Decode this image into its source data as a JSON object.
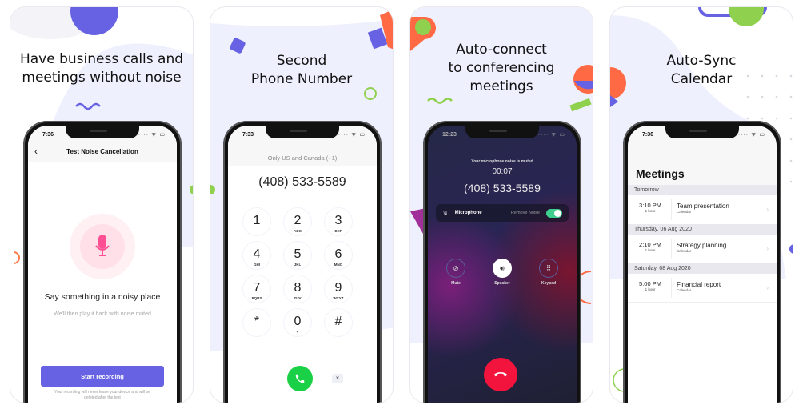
{
  "panels": [
    {
      "headline_lines": [
        "Have business calls and",
        "meetings without noise"
      ],
      "status_time": "7:36",
      "screen_title": "Test Noise Cancellation",
      "back_icon": "chevron-left-icon",
      "prompt": "Say something in a noisy place",
      "subprompt": "We'll then play it back with noise muted",
      "button_label": "Start recording",
      "footnote": "Your recording will never leave your device and will be deleted after the test",
      "accent": "#6762e3",
      "mic_color": "#ff4f93"
    },
    {
      "headline_lines": [
        "Second",
        "Phone Number"
      ],
      "status_time": "7:33",
      "region_note": "Only US and Canada (+1)",
      "entered_number": "(408) 533-5589",
      "keys": [
        {
          "digit": "1",
          "letters": ""
        },
        {
          "digit": "2",
          "letters": "ABC"
        },
        {
          "digit": "3",
          "letters": "DEF"
        },
        {
          "digit": "4",
          "letters": "GHI"
        },
        {
          "digit": "5",
          "letters": "JKL"
        },
        {
          "digit": "6",
          "letters": "MNO"
        },
        {
          "digit": "7",
          "letters": "PQRS"
        },
        {
          "digit": "8",
          "letters": "TUV"
        },
        {
          "digit": "9",
          "letters": "WXYZ"
        },
        {
          "digit": "*",
          "letters": ""
        },
        {
          "digit": "0",
          "letters": "+"
        },
        {
          "digit": "#",
          "letters": ""
        }
      ],
      "delete_glyph": "×",
      "call_color": "#19d046"
    },
    {
      "headline_lines": [
        "Auto-connect",
        "to conferencing",
        "meetings"
      ],
      "status_time": "12:23",
      "muted_note": "Your microphone noise is muted",
      "timer": "00:07",
      "number": "(408) 533-5589",
      "mic_label": "Microphone",
      "remove_noise_label": "Remove Noise",
      "remove_noise_on": true,
      "controls": [
        {
          "label": "Mute",
          "icon": "mic-off-icon",
          "active": false
        },
        {
          "label": "Speaker",
          "icon": "speaker-icon",
          "active": true
        },
        {
          "label": "Keypad",
          "icon": "keypad-icon",
          "active": false
        }
      ],
      "end_color": "#f2143c"
    },
    {
      "headline_lines": [
        "Auto-Sync",
        "Calendar"
      ],
      "status_time": "7:36",
      "screen_title": "Meetings",
      "sections": [
        {
          "label": "Tomorrow",
          "items": [
            {
              "time": "3:10 PM",
              "duration": "1 hour",
              "title": "Team presentation",
              "source": "Calendar"
            }
          ]
        },
        {
          "label": "Thursday, 06 Aug 2020",
          "items": [
            {
              "time": "2:10 PM",
              "duration": "1 hour",
              "title": "Strategy planning",
              "source": "Calendar"
            }
          ]
        },
        {
          "label": "Saturday, 08 Aug 2020",
          "items": [
            {
              "time": "5:00 PM",
              "duration": "1 hour",
              "title": "Financial report",
              "source": "Calendar"
            }
          ]
        }
      ]
    }
  ],
  "status_icons": "···· ᯤ ▭"
}
